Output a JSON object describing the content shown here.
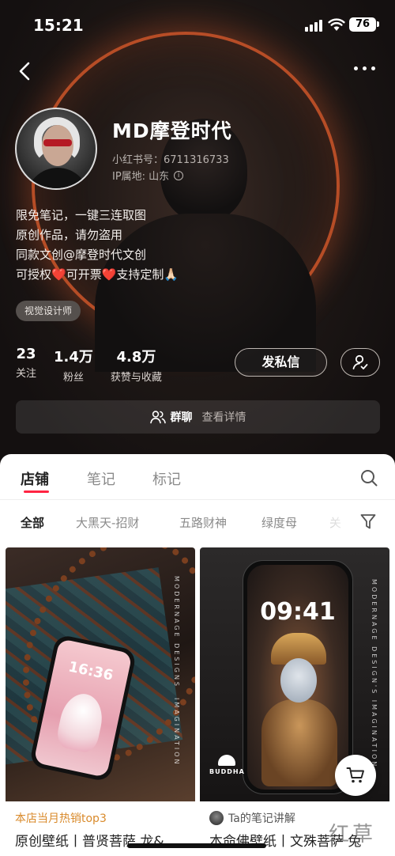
{
  "status_bar": {
    "time": "15:21",
    "battery": "76"
  },
  "profile": {
    "name": "MD摩登时代",
    "id_label": "小红书号：6711316733",
    "ip_label": "IP属地: 山东",
    "bio": {
      "line1": "限免笔记，一键三连取图",
      "line2": "原创作品，请勿盗用",
      "line3": "同款文创@摩登时代文创",
      "line4_a": "可授权",
      "line4_b": "可开票",
      "line4_c": "支持定制",
      "heart_glyph": "❤️",
      "pray_glyph": "🙏🏻"
    },
    "tag": "视觉设计师",
    "stats": [
      {
        "num": "23",
        "label": "关注"
      },
      {
        "num": "1.4万",
        "label": "粉丝"
      },
      {
        "num": "4.8万",
        "label": "获赞与收藏"
      }
    ],
    "message_button": "发私信",
    "group": {
      "title": "群聊",
      "detail": "查看详情"
    }
  },
  "tabs": [
    {
      "label": "店铺"
    },
    {
      "label": "笔记"
    },
    {
      "label": "标记"
    }
  ],
  "filters": [
    {
      "label": "全部"
    },
    {
      "label": "大黑天-招财"
    },
    {
      "label": "五路财神"
    },
    {
      "label": "绿度母"
    },
    {
      "label": "关"
    }
  ],
  "cards": [
    {
      "meta": "本店当月热销top3",
      "title": "原创壁纸丨普贤菩萨 龙&",
      "phone_time": "16:36",
      "side_text_1": "MODERNAGE DESIGNS",
      "side_text_2": "IMAGINATION"
    },
    {
      "meta": "Ta的笔记讲解",
      "title": "本命佛壁纸丨文殊菩萨 兔",
      "phone_time": "09:41",
      "side_text": "MODERNAGE DESIGN'S IMAGINATION",
      "logo_text": "BUDDHA"
    }
  ],
  "watermark": "红草",
  "colors": {
    "accent_red": "#ff2442",
    "halo_orange": "#d2572a",
    "hot_orange": "#d98a2b"
  }
}
